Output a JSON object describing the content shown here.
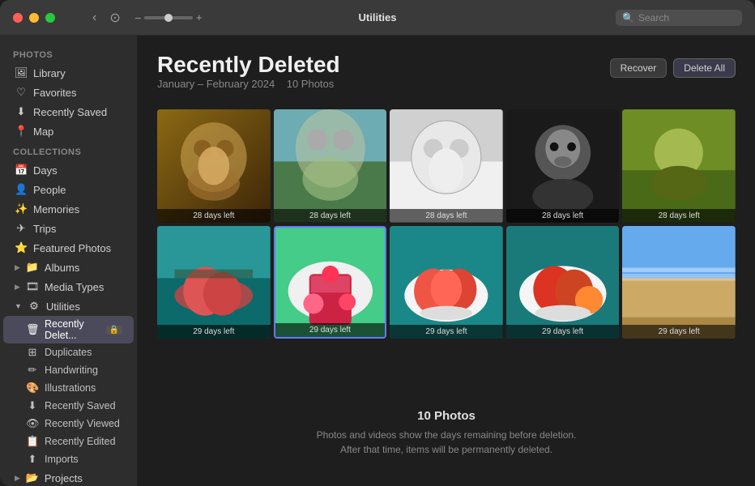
{
  "titlebar": {
    "title": "Utilities",
    "back_btn": "‹",
    "rotate_icon": "⟳",
    "zoom_minus": "–",
    "zoom_plus": "+",
    "search_placeholder": "Search"
  },
  "sidebar": {
    "photos_label": "Photos",
    "collections_label": "Collections",
    "photos_items": [
      {
        "id": "library",
        "label": "Library",
        "icon": "🖼"
      },
      {
        "id": "favorites",
        "label": "Favorites",
        "icon": "♡"
      },
      {
        "id": "recently-saved",
        "label": "Recently Saved",
        "icon": "⬇"
      },
      {
        "id": "map",
        "label": "Map",
        "icon": "📍"
      }
    ],
    "collections_items": [
      {
        "id": "days",
        "label": "Days",
        "icon": "📅"
      },
      {
        "id": "people",
        "label": "People",
        "icon": "👤"
      },
      {
        "id": "memories",
        "label": "Memories",
        "icon": "✨"
      },
      {
        "id": "trips",
        "label": "Trips",
        "icon": "✈"
      },
      {
        "id": "featured-photos",
        "label": "Featured Photos",
        "icon": "⭐"
      },
      {
        "id": "albums",
        "label": "Albums",
        "icon": "📁",
        "expandable": true
      },
      {
        "id": "media-types",
        "label": "Media Types",
        "icon": "🎥",
        "expandable": true
      },
      {
        "id": "utilities",
        "label": "Utilities",
        "icon": "⚙",
        "expandable": true,
        "expanded": true
      }
    ],
    "utilities_sub_items": [
      {
        "id": "recently-deleted",
        "label": "Recently Delet...",
        "icon": "🗑",
        "active": true
      },
      {
        "id": "duplicates",
        "label": "Duplicates",
        "icon": "⊞"
      },
      {
        "id": "handwriting",
        "label": "Handwriting",
        "icon": "✏"
      },
      {
        "id": "illustrations",
        "label": "Illustrations",
        "icon": "🎨"
      },
      {
        "id": "recently-saved-sub",
        "label": "Recently Saved",
        "icon": "⬇"
      },
      {
        "id": "recently-viewed",
        "label": "Recently Viewed",
        "icon": "👁"
      },
      {
        "id": "recently-edited",
        "label": "Recently Edited",
        "icon": "📋"
      },
      {
        "id": "imports",
        "label": "Imports",
        "icon": "⬆"
      }
    ],
    "projects_item": {
      "id": "projects",
      "label": "Projects",
      "icon": "📂",
      "expandable": true
    }
  },
  "content": {
    "title": "Recently Deleted",
    "subtitle": "January – February 2024",
    "photo_count_label": "10 Photos",
    "recover_btn": "Recover",
    "delete_all_btn": "Delete All",
    "footer_count": "10 Photos",
    "footer_line1": "Photos and videos show the days remaining before deletion.",
    "footer_line2": "After that time, items will be permanently deleted.",
    "photos": [
      {
        "id": "p1",
        "days": "28 days left",
        "style": "dog1"
      },
      {
        "id": "p2",
        "days": "28 days left",
        "style": "dog2"
      },
      {
        "id": "p3",
        "days": "28 days left",
        "style": "dog3"
      },
      {
        "id": "p4",
        "days": "28 days left",
        "style": "girl1"
      },
      {
        "id": "p5",
        "days": "28 days left",
        "style": "girl2"
      },
      {
        "id": "p6",
        "days": "29 days left",
        "style": "bowl1"
      },
      {
        "id": "p7",
        "days": "29 days left",
        "style": "bowl2"
      },
      {
        "id": "p8",
        "days": "29 days left",
        "style": "bowl3"
      },
      {
        "id": "p9",
        "days": "29 days left",
        "style": "bowl4"
      },
      {
        "id": "p10",
        "days": "29 days left",
        "style": "beach"
      }
    ]
  }
}
